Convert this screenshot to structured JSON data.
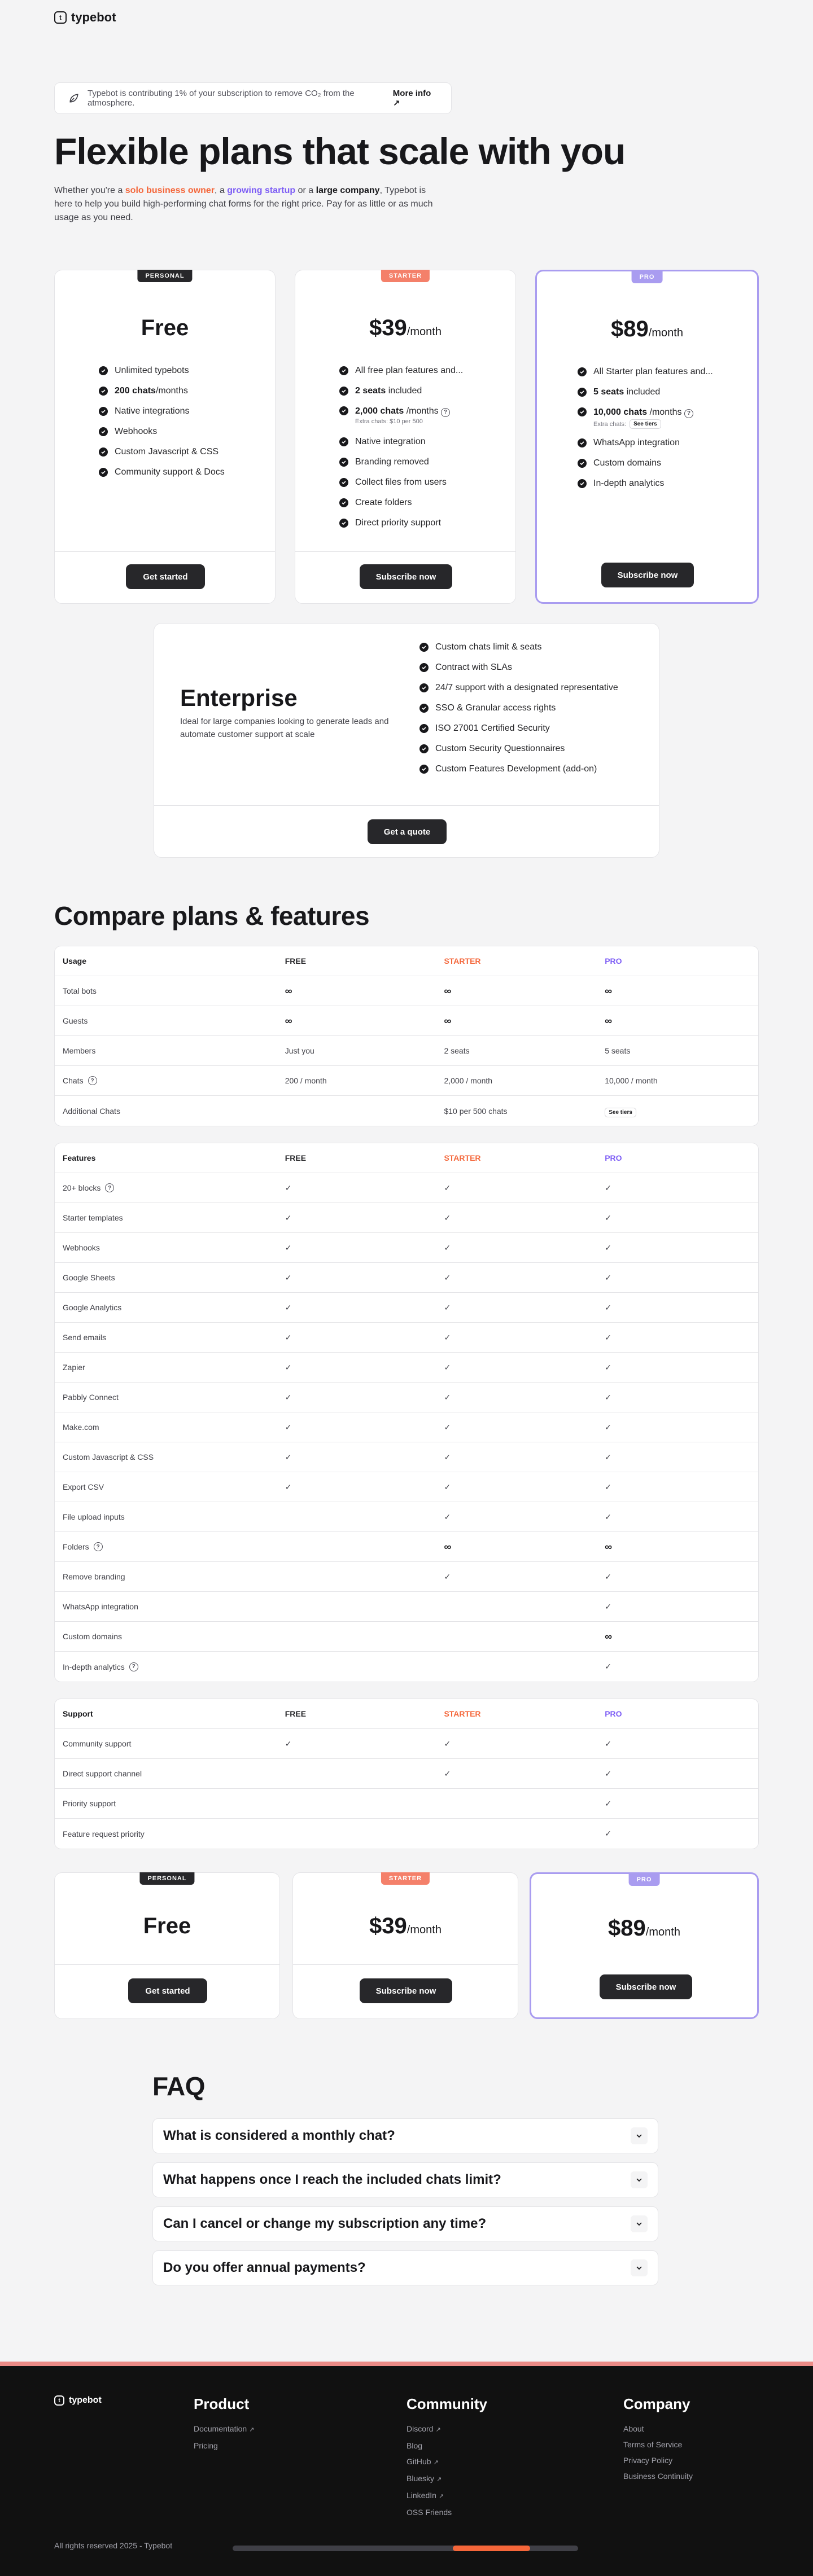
{
  "brand": {
    "name": "typebot",
    "mark": "t"
  },
  "banner": {
    "text": "Typebot is contributing 1% of your subscription to remove CO₂ from the atmosphere.",
    "link": "More info",
    "link_arrow": "↗"
  },
  "hero": {
    "title": "Flexible plans that scale with you",
    "sub_1": "Whether you're a ",
    "solo": "solo business owner",
    "sub_2": ", a ",
    "startup": "growing startup",
    "sub_3": " or a ",
    "large": "large company",
    "sub_4": ", Typebot is here to help you build high-performing chat forms for the right price. Pay for as little or as much usage as you need."
  },
  "plans": {
    "personal": {
      "badge": "PERSONAL",
      "price": "Free",
      "cta": "Get started",
      "features": [
        "Unlimited typebots",
        "200 chats",
        "/months",
        "Native integrations",
        "Webhooks",
        "Custom Javascript & CSS",
        "Community support & Docs"
      ]
    },
    "starter": {
      "badge": "STARTER",
      "price": "$39",
      "per": "/month",
      "cta": "Subscribe now",
      "features": [
        "All free plan features and...",
        "2 seats",
        " included",
        "2,000 chats",
        " /months",
        "Extra chats: $10 per 500",
        "Native integration",
        "Branding removed",
        "Collect files from users",
        "Create folders",
        "Direct priority support"
      ]
    },
    "pro": {
      "badge": "PRO",
      "price": "$89",
      "per": "/month",
      "cta": "Subscribe now",
      "features": [
        "All Starter plan features and...",
        "5 seats",
        " included",
        "10,000 chats",
        " /months",
        "Extra chats:",
        "See tiers",
        "WhatsApp integration",
        "Custom domains",
        "In-depth analytics"
      ]
    },
    "enterprise": {
      "title": "Enterprise",
      "desc": "Ideal for large companies looking to generate leads and automate customer support at scale",
      "cta": "Get a quote",
      "features": [
        "Custom chats limit & seats",
        "Contract with SLAs",
        "24/7 support with a designated representative",
        "SSO & Granular access rights",
        "ISO 27001 Certified Security",
        "Custom Security Questionnaires",
        "Custom Features Development (add-on)"
      ]
    }
  },
  "compare": {
    "title": "Compare plans & features",
    "cols": [
      "FREE",
      "STARTER",
      "PRO"
    ],
    "usage": {
      "head": "Usage",
      "rows": [
        {
          "label": "Total bots",
          "free": "∞",
          "starter": "∞",
          "pro": "∞"
        },
        {
          "label": "Guests",
          "free": "∞",
          "starter": "∞",
          "pro": "∞"
        },
        {
          "label": "Members",
          "free": "Just you",
          "starter": "2 seats",
          "pro": "5 seats"
        },
        {
          "label": "Chats",
          "free": "200 / month",
          "starter": "2,000 / month",
          "pro": "10,000 / month"
        },
        {
          "label": "Additional Chats",
          "free": "",
          "starter": "$10 per 500 chats",
          "pro": "See tiers"
        }
      ]
    },
    "features": {
      "head": "Features",
      "rows": [
        {
          "label": "20+ blocks",
          "free": "✓",
          "starter": "✓",
          "pro": "✓"
        },
        {
          "label": "Starter templates",
          "free": "✓",
          "starter": "✓",
          "pro": "✓"
        },
        {
          "label": "Webhooks",
          "free": "✓",
          "starter": "✓",
          "pro": "✓"
        },
        {
          "label": "Google Sheets",
          "free": "✓",
          "starter": "✓",
          "pro": "✓"
        },
        {
          "label": "Google Analytics",
          "free": "✓",
          "starter": "✓",
          "pro": "✓"
        },
        {
          "label": "Send emails",
          "free": "✓",
          "starter": "✓",
          "pro": "✓"
        },
        {
          "label": "Zapier",
          "free": "✓",
          "starter": "✓",
          "pro": "✓"
        },
        {
          "label": "Pabbly Connect",
          "free": "✓",
          "starter": "✓",
          "pro": "✓"
        },
        {
          "label": "Make.com",
          "free": "✓",
          "starter": "✓",
          "pro": "✓"
        },
        {
          "label": "Custom Javascript & CSS",
          "free": "✓",
          "starter": "✓",
          "pro": "✓"
        },
        {
          "label": "Export CSV",
          "free": "✓",
          "starter": "✓",
          "pro": "✓"
        },
        {
          "label": "File upload inputs",
          "free": "",
          "starter": "✓",
          "pro": "✓"
        },
        {
          "label": "Folders",
          "free": "",
          "starter": "∞",
          "pro": "∞"
        },
        {
          "label": "Remove branding",
          "free": "",
          "starter": "✓",
          "pro": "✓"
        },
        {
          "label": "WhatsApp integration",
          "free": "",
          "starter": "",
          "pro": "✓"
        },
        {
          "label": "Custom domains",
          "free": "",
          "starter": "",
          "pro": "∞"
        },
        {
          "label": "In-depth analytics",
          "free": "",
          "starter": "",
          "pro": "✓"
        }
      ]
    },
    "support": {
      "head": "Support",
      "rows": [
        {
          "label": "Community support",
          "free": "✓",
          "starter": "✓",
          "pro": "✓"
        },
        {
          "label": "Direct support channel",
          "free": "",
          "starter": "✓",
          "pro": "✓"
        },
        {
          "label": "Priority support",
          "free": "",
          "starter": "",
          "pro": "✓"
        },
        {
          "label": "Feature request priority",
          "free": "",
          "starter": "",
          "pro": "✓"
        }
      ]
    }
  },
  "faq": {
    "title": "FAQ",
    "items": [
      "What is considered a monthly chat?",
      "What happens once I reach the included chats limit?",
      "Can I cancel or change my subscription any time?",
      "Do you offer annual payments?"
    ]
  },
  "footer": {
    "brand": "typebot",
    "product": {
      "title": "Product",
      "links": [
        "Documentation",
        "Pricing"
      ]
    },
    "community": {
      "title": "Community",
      "links": [
        "Discord",
        "Blog",
        "GitHub",
        "Bluesky",
        "LinkedIn",
        "OSS Friends"
      ]
    },
    "company": {
      "title": "Company",
      "links": [
        "About",
        "Terms of Service",
        "Privacy Policy",
        "Business Continuity"
      ]
    },
    "copyright": "All rights reserved 2025 - Typebot",
    "ext_arrow": "↗"
  },
  "scroll_position": 0.82,
  "colors": {
    "orange": "#f4663a",
    "purple": "#7c5cf5",
    "pro_border": "#a99cf0",
    "dark": "#18181b"
  }
}
